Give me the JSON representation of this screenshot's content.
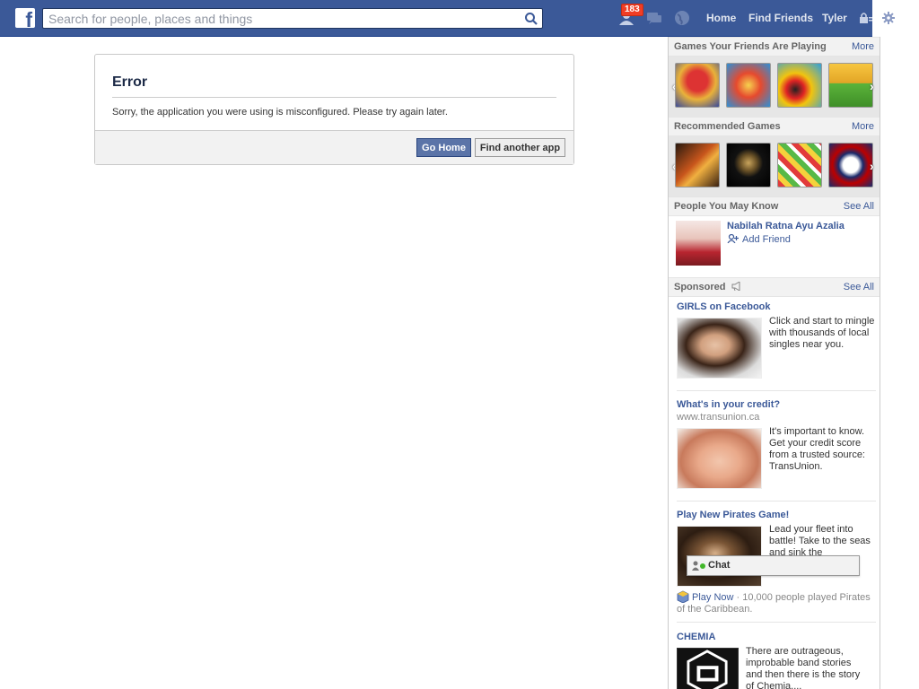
{
  "header": {
    "logo_letter": "f",
    "search_placeholder": "Search for people, places and things",
    "notification_count": "183",
    "nav": [
      "Home",
      "Find Friends",
      "Tyler"
    ]
  },
  "dialog": {
    "title": "Error",
    "message": "Sorry, the application you were using is misconfigured. Please try again later.",
    "primary_button": "Go Home",
    "secondary_button": "Find another app"
  },
  "sidebar": {
    "games_friends": {
      "title": "Games Your Friends Are Playing",
      "action": "More"
    },
    "recommended_games": {
      "title": "Recommended Games",
      "action": "More"
    },
    "people_you_may_know": {
      "title": "People You May Know",
      "action": "See All",
      "person_name": "Nabilah Ratna Ayu Azalia",
      "add_label": "Add Friend"
    },
    "sponsored": {
      "title": "Sponsored",
      "action": "See All",
      "ads": [
        {
          "title": "GIRLS on Facebook",
          "url": "",
          "body": "Click and start to mingle with thousands of local singles near you."
        },
        {
          "title": "What's in your credit?",
          "url": "www.transunion.ca",
          "body": "It's important to know. Get your credit score from a trusted source: TransUnion."
        },
        {
          "title": "Play New Pirates Game!",
          "url": "",
          "body": "Lead your fleet into battle! Take to the seas and sink the",
          "play_now": "Play Now",
          "play_stats": " · 10,000 people played Pirates of the Caribbean."
        },
        {
          "title": "CHEMIA",
          "url": "",
          "body": "There are outrageous, improbable band stories and then there is the story of Chemia,..."
        }
      ]
    }
  },
  "chat": {
    "label": "Chat"
  },
  "colors": {
    "brand": "#3b5998",
    "badge": "#f03d25",
    "online": "#42b72a"
  }
}
